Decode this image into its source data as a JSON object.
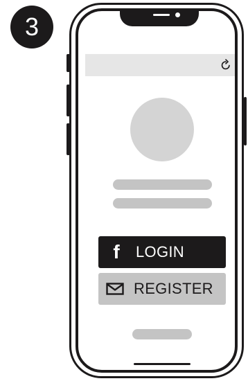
{
  "step": {
    "number": "3"
  },
  "browser": {
    "refresh_icon": "refresh-icon"
  },
  "profile": {
    "avatar_icon": "avatar-placeholder"
  },
  "auth": {
    "login_label": "LOGIN",
    "login_icon": "facebook-icon",
    "register_label": "REGISTER",
    "register_icon": "envelope-icon"
  },
  "colors": {
    "dark": "#1c1a1b",
    "light_gray": "#e6e6e6",
    "mid_gray": "#c4c4c4",
    "avatar_gray": "#d4d4d4"
  }
}
